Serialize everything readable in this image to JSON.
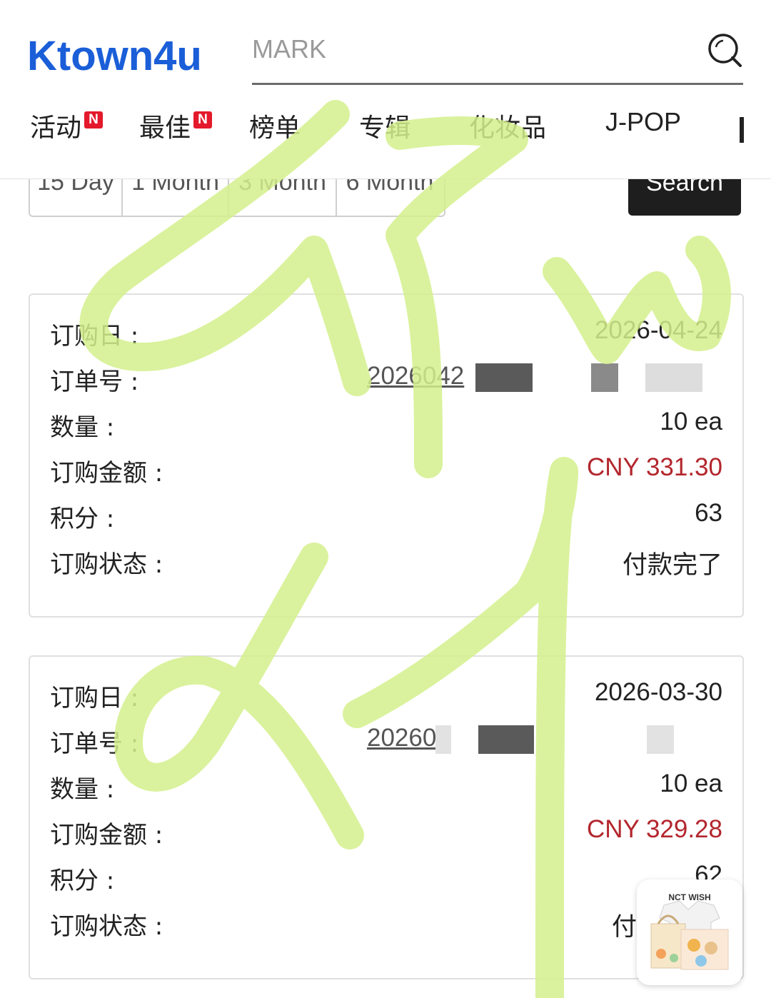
{
  "header": {
    "logo_text": "Ktown4u",
    "search_placeholder": "MARK"
  },
  "nav": [
    {
      "label": "活动",
      "badge": "N"
    },
    {
      "label": "最佳",
      "badge": "N"
    },
    {
      "label": "榜单"
    },
    {
      "label": "专辑"
    },
    {
      "label": "化妆品"
    },
    {
      "label": "J-POP"
    }
  ],
  "period_filter": {
    "options": [
      "15 Day",
      "1 Month",
      "3 Month",
      "6 Month"
    ],
    "search_label": "Search"
  },
  "orders": [
    {
      "labels": {
        "date": "订购日 :",
        "order_no": "订单号 :",
        "qty": "数量 :",
        "amount": "订购金额 :",
        "points": "积分 :",
        "status": "订购状态 :"
      },
      "date": "2026-04-24",
      "order_no_visible": "2026042",
      "qty": "10 ea",
      "amount": "CNY 331.30",
      "points": "63",
      "status": "付款完了"
    },
    {
      "labels": {
        "date": "订购日 :",
        "order_no": "订单号 :",
        "qty": "数量 :",
        "amount": "订购金额 :",
        "points": "积分 :",
        "status": "订购状态 :"
      },
      "date": "2026-03-30",
      "order_no_visible": "20260",
      "qty": "10 ea",
      "amount": "CNY 329.28",
      "points": "62",
      "status": "付"
    }
  ],
  "floating_ad": {
    "title": "NCT WISH"
  },
  "colors": {
    "brand_blue": "#1a5ed8",
    "badge_red": "#e4192b",
    "amount_red": "#b3262d",
    "watermark_green": "#d4f08c"
  }
}
